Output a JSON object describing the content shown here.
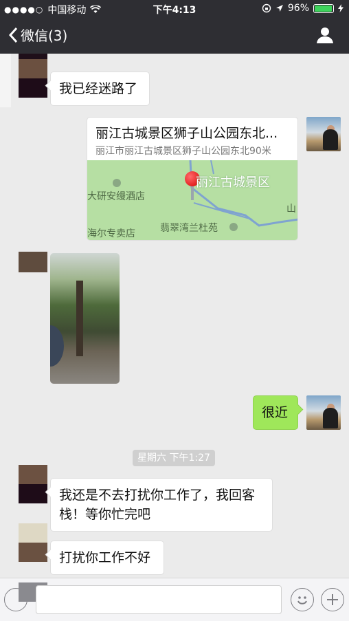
{
  "status_bar": {
    "signal_dots": "●●●●○",
    "carrier": "中国移动",
    "time": "下午4:13",
    "battery": "96%",
    "colors": {
      "battery_fill": "#3ed35c"
    }
  },
  "nav": {
    "back_label": "微信(3)",
    "back_icon": "chevron-left-icon",
    "profile_icon": "person-icon"
  },
  "messages": [
    {
      "side": "left",
      "type": "text",
      "text": "我已经迷路了"
    },
    {
      "side": "right",
      "type": "location",
      "title": "丽江古城景区狮子山公园东北...",
      "address": "丽江市丽江古城景区狮子山公园东北90米",
      "map_labels": {
        "main": "丽江古城景区",
        "hotel": "大研安缦酒店",
        "shop": "海尔专卖店",
        "garden": "翡翠湾兰杜苑",
        "edge": "山"
      }
    },
    {
      "side": "left",
      "type": "image"
    },
    {
      "side": "right",
      "type": "text",
      "text": "很近"
    },
    {
      "type": "timestamp",
      "text": "星期六 下午1:27"
    },
    {
      "side": "left",
      "type": "text",
      "text": "我还是不去打扰你工作了，我回客栈！等你忙完吧"
    },
    {
      "side": "left",
      "type": "text",
      "text": "打扰你工作不好"
    }
  ],
  "input_bar": {
    "emoji_icon": "emoji-icon",
    "plus_icon": "plus-icon"
  },
  "colors": {
    "nav_bg": "#2e2e33",
    "chat_bg": "#ebebeb",
    "green_bubble": "#9fe75a"
  }
}
